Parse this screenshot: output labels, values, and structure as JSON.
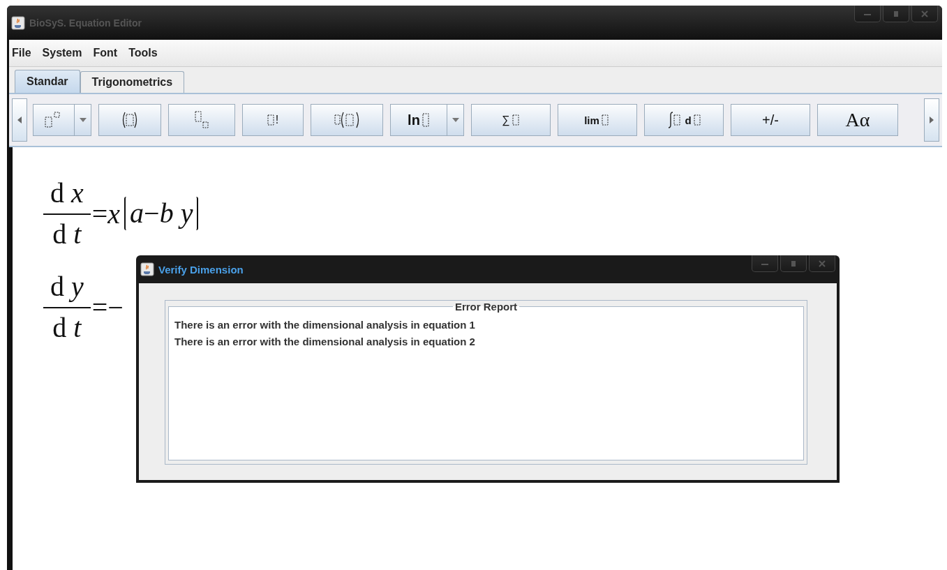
{
  "window": {
    "title": "BioSyS. Equation Editor"
  },
  "menu": [
    "File",
    "System",
    "Font",
    "Tools"
  ],
  "tabs": [
    {
      "label": "Standar",
      "selected": true
    },
    {
      "label": "Trigonometrics",
      "selected": false
    }
  ],
  "toolbar": [
    {
      "kind": "power",
      "dropdown": true
    },
    {
      "kind": "paren",
      "dropdown": false
    },
    {
      "kind": "subscript",
      "dropdown": false
    },
    {
      "kind": "factorial",
      "label": "!",
      "dropdown": false
    },
    {
      "kind": "function",
      "dropdown": false
    },
    {
      "kind": "log",
      "label": "ln",
      "dropdown": true
    },
    {
      "kind": "sum",
      "label": "∑",
      "dropdown": false
    },
    {
      "kind": "limit",
      "label": "lim",
      "dropdown": false
    },
    {
      "kind": "integral",
      "label": "d",
      "dropdown": false
    },
    {
      "kind": "text",
      "label": "+/-",
      "dropdown": false
    },
    {
      "kind": "greek",
      "label": "Aα",
      "dropdown": false
    }
  ],
  "equations": [
    {
      "numerator": "d *x*",
      "denominator": "d *t*",
      "rhs": "=*x*",
      "bracketed": "*a*−*b* *y*"
    },
    {
      "numerator": "d *y*",
      "denominator": "d *t*",
      "rhs": "=−"
    }
  ],
  "dialog": {
    "title": "Verify Dimension",
    "group_title": "Error Report",
    "lines": [
      "There is an error with the dimensional analysis in equation 1",
      "There is an error with the dimensional analysis in equation 2"
    ]
  }
}
